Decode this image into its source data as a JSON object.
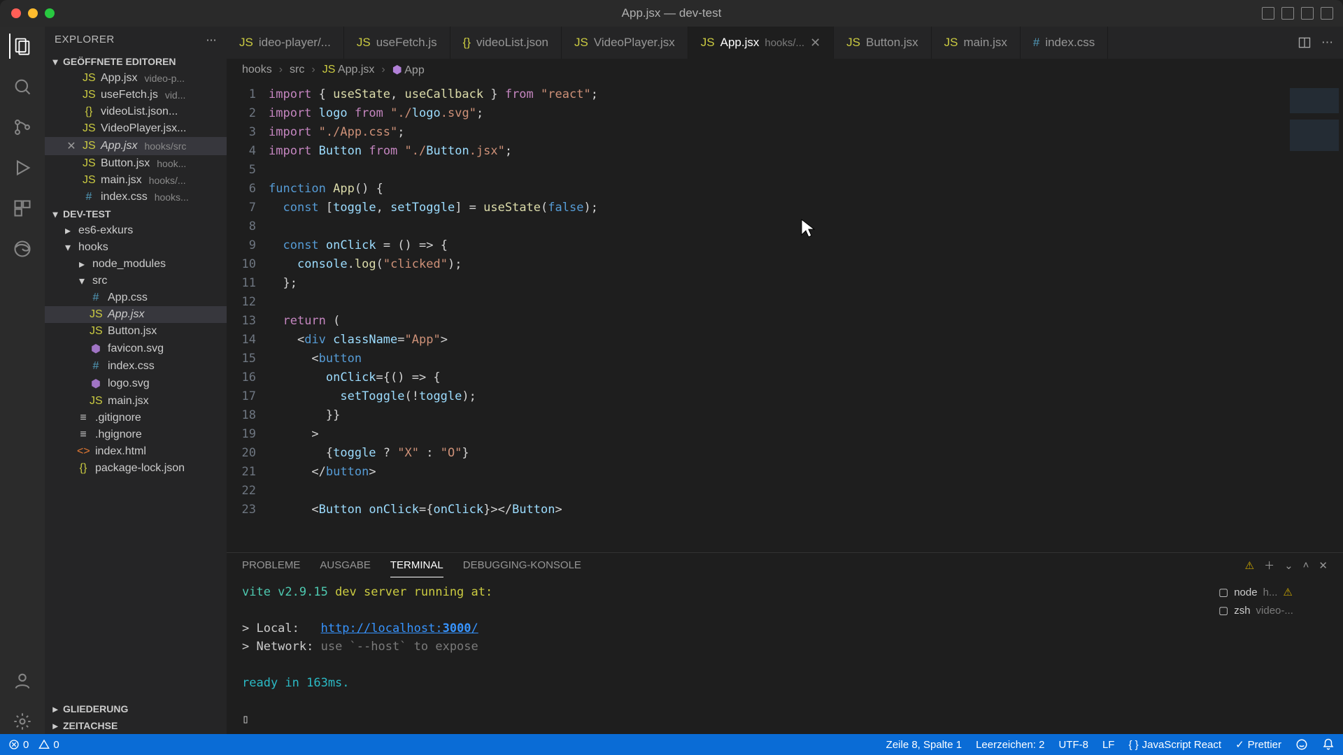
{
  "window": {
    "title": "App.jsx — dev-test"
  },
  "sidebar": {
    "title": "EXPLORER",
    "sections": {
      "openEditors": "GEÖFFNETE EDITOREN",
      "project": "DEV-TEST",
      "outline": "GLIEDERUNG",
      "timeline": "ZEITACHSE"
    },
    "openEditors": [
      {
        "icon": "jsx",
        "name": "App.jsx",
        "dir": "video-p..."
      },
      {
        "icon": "js",
        "name": "useFetch.js",
        "dir": "vid..."
      },
      {
        "icon": "json",
        "name": "videoList.json...",
        "dir": ""
      },
      {
        "icon": "jsx",
        "name": "VideoPlayer.jsx...",
        "dir": ""
      },
      {
        "icon": "jsx",
        "name": "App.jsx",
        "dir": "hooks/src",
        "active": true,
        "close": true
      },
      {
        "icon": "jsx",
        "name": "Button.jsx",
        "dir": "hook..."
      },
      {
        "icon": "jsx",
        "name": "main.jsx",
        "dir": "hooks/..."
      },
      {
        "icon": "css",
        "name": "index.css",
        "dir": "hooks..."
      }
    ],
    "tree": [
      {
        "depth": 1,
        "kind": "folder",
        "open": false,
        "name": "es6-exkurs"
      },
      {
        "depth": 1,
        "kind": "folder",
        "open": true,
        "name": "hooks"
      },
      {
        "depth": 2,
        "kind": "folder",
        "open": false,
        "name": "node_modules"
      },
      {
        "depth": 2,
        "kind": "folder",
        "open": true,
        "name": "src"
      },
      {
        "depth": 3,
        "kind": "file",
        "icon": "css",
        "name": "App.css"
      },
      {
        "depth": 3,
        "kind": "file",
        "icon": "jsx",
        "name": "App.jsx",
        "active": true
      },
      {
        "depth": 3,
        "kind": "file",
        "icon": "jsx",
        "name": "Button.jsx"
      },
      {
        "depth": 3,
        "kind": "file",
        "icon": "svg",
        "name": "favicon.svg"
      },
      {
        "depth": 3,
        "kind": "file",
        "icon": "css",
        "name": "index.css"
      },
      {
        "depth": 3,
        "kind": "file",
        "icon": "svg",
        "name": "logo.svg"
      },
      {
        "depth": 3,
        "kind": "file",
        "icon": "jsx",
        "name": "main.jsx"
      },
      {
        "depth": 2,
        "kind": "file",
        "icon": "txt",
        "name": ".gitignore"
      },
      {
        "depth": 2,
        "kind": "file",
        "icon": "txt",
        "name": ".hgignore"
      },
      {
        "depth": 2,
        "kind": "file",
        "icon": "html",
        "name": "index.html"
      },
      {
        "depth": 2,
        "kind": "file",
        "icon": "json",
        "name": "package-lock.json"
      }
    ]
  },
  "tabs": [
    {
      "icon": "jsx",
      "label": "ideo-player/...",
      "truncated": true
    },
    {
      "icon": "js",
      "label": "useFetch.js"
    },
    {
      "icon": "json",
      "label": "videoList.json"
    },
    {
      "icon": "jsx",
      "label": "VideoPlayer.jsx"
    },
    {
      "icon": "jsx",
      "label": "App.jsx",
      "path": "hooks/...",
      "active": true,
      "close": true
    },
    {
      "icon": "jsx",
      "label": "Button.jsx"
    },
    {
      "icon": "jsx",
      "label": "main.jsx"
    },
    {
      "icon": "css",
      "label": "index.css"
    }
  ],
  "breadcrumbs": [
    "hooks",
    "src",
    "App.jsx",
    "App"
  ],
  "code": {
    "lines": [
      "import { useState, useCallback } from \"react\";",
      "import logo from \"./logo.svg\";",
      "import \"./App.css\";",
      "import Button from \"./Button.jsx\";",
      "",
      "function App() {",
      "  const [toggle, setToggle] = useState(false);",
      "",
      "  const onClick = () => {",
      "    console.log(\"clicked\");",
      "  };",
      "",
      "  return (",
      "    <div className=\"App\">",
      "      <button",
      "        onClick={() => {",
      "          setToggle(!toggle);",
      "        }}",
      "      >",
      "        {toggle ? \"X\" : \"O\"}",
      "      </button>",
      "",
      "      <Button onClick={onClick}></Button>"
    ],
    "firstLine": 1
  },
  "panel": {
    "tabs": {
      "problems": "PROBLEME",
      "output": "AUSGABE",
      "terminal": "TERMINAL",
      "debug": "DEBUGGING-KONSOLE"
    },
    "terminal": {
      "line1_a": "vite v2.9.15",
      "line1_b": " dev server running at:",
      "local_label": "> Local:   ",
      "local_url_a": "http://localhost:",
      "local_url_port": "3000",
      "local_url_b": "/",
      "network_label": "> Network: ",
      "network_hint": "use `--host` to expose",
      "ready": "ready in 163ms.",
      "prompt": "▯"
    },
    "sessions": [
      {
        "icon": "term",
        "name": "node",
        "path": "h...",
        "warn": true
      },
      {
        "icon": "term",
        "name": "zsh",
        "path": "video-..."
      }
    ]
  },
  "status": {
    "errors": "0",
    "warnings": "0",
    "position": "Zeile 8, Spalte 1",
    "indent": "Leerzeichen: 2",
    "encoding": "UTF-8",
    "eol": "LF",
    "lang": "JavaScript React",
    "prettier": "Prettier"
  },
  "iconGlyphs": {
    "jsx": "JS",
    "js": "JS",
    "json": "{}",
    "css": "#",
    "svg": "⬢",
    "html": "<>",
    "txt": "≡"
  }
}
